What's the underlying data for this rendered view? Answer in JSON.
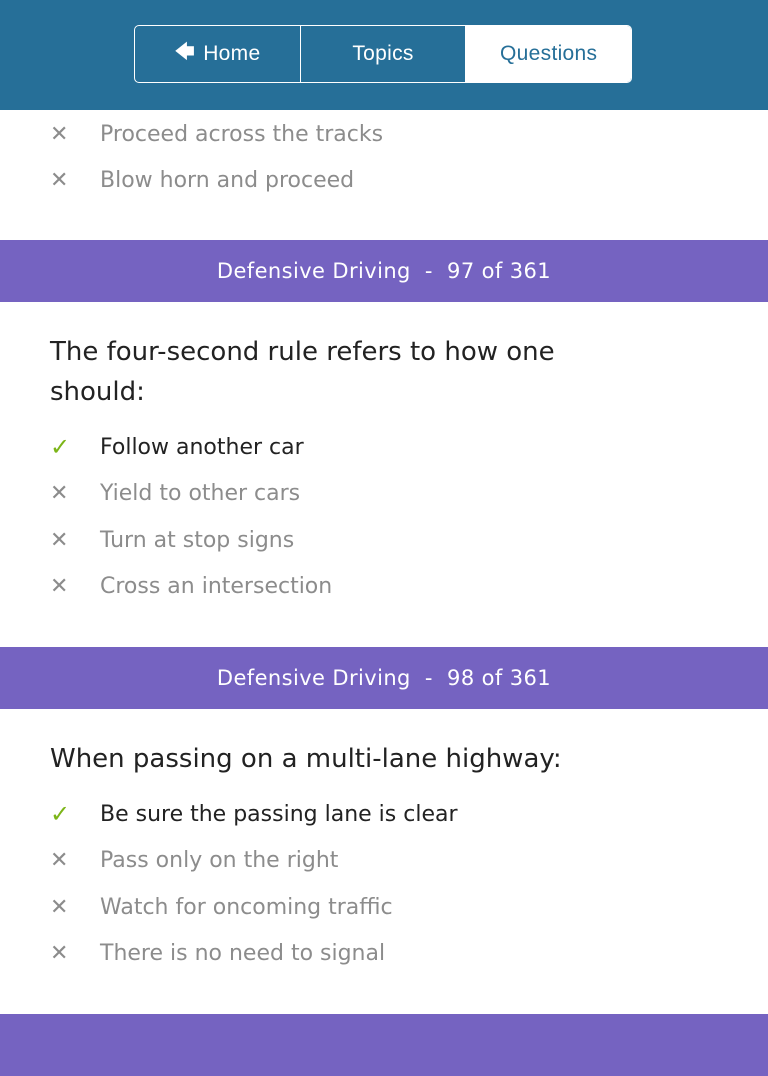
{
  "nav": {
    "home_label": "Home",
    "home_icon": "arrow-left-icon",
    "topics_label": "Topics",
    "questions_label": "Questions",
    "active_tab": "Questions"
  },
  "colors": {
    "header": "#266f98",
    "band": "#7563c1",
    "correct": "#7cb518",
    "wrong": "#8c8c8c"
  },
  "marks": {
    "correct": "✓",
    "wrong": "✕"
  },
  "previous_answers": [
    {
      "text": "Proceed across the tracks",
      "correct": false
    },
    {
      "text": "Blow horn and proceed",
      "correct": false
    }
  ],
  "questions": [
    {
      "topic": "Defensive Driving",
      "position": "97 of 361",
      "band_label": "Defensive Driving  -  97 of 361",
      "question": "The four-second rule refers to how one should:",
      "answers": [
        {
          "text": "Follow another car",
          "correct": true
        },
        {
          "text": "Yield to other cars",
          "correct": false
        },
        {
          "text": "Turn at stop signs",
          "correct": false
        },
        {
          "text": "Cross an intersection",
          "correct": false
        }
      ]
    },
    {
      "topic": "Defensive Driving",
      "position": "98 of 361",
      "band_label": "Defensive Driving  -  98 of 361",
      "question": "When passing on a multi-lane highway:",
      "answers": [
        {
          "text": "Be sure the passing lane is clear",
          "correct": true
        },
        {
          "text": "Pass only on the right",
          "correct": false
        },
        {
          "text": "Watch for oncoming traffic",
          "correct": false
        },
        {
          "text": "There is no need to signal",
          "correct": false
        }
      ]
    }
  ]
}
